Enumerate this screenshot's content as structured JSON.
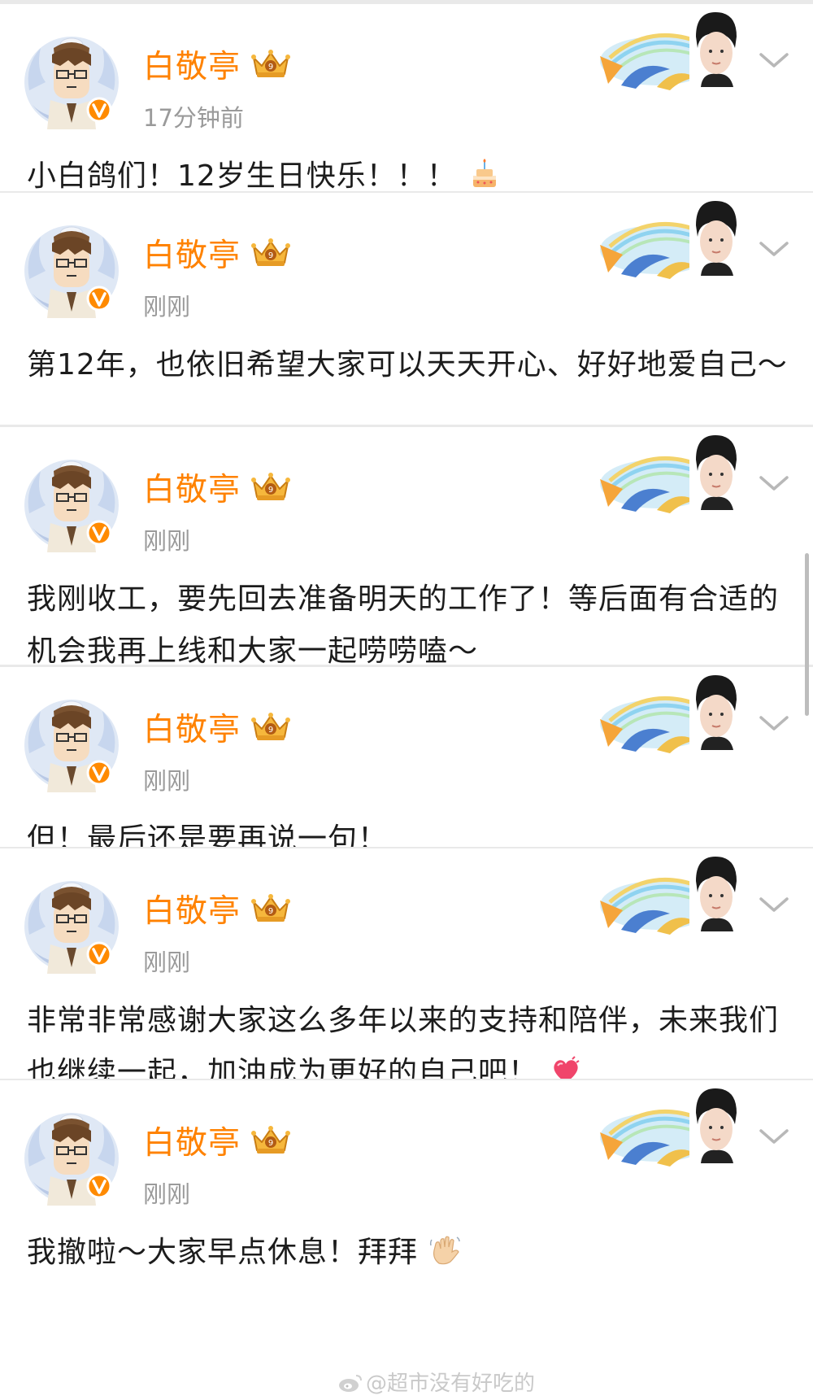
{
  "posts": [
    {
      "username": "白敬亭",
      "timestamp": "17分钟前",
      "text": "小白鸽们！12岁生日快乐！！！",
      "emoji": "birthday-cake"
    },
    {
      "username": "白敬亭",
      "timestamp": "刚刚",
      "text": "第12年，也依旧希望大家可以天天开心、好好地爱自己～",
      "emoji": ""
    },
    {
      "username": "白敬亭",
      "timestamp": "刚刚",
      "text": "我刚收工，要先回去准备明天的工作了！等后面有合适的机会我再上线和大家一起唠唠嗑～",
      "emoji": ""
    },
    {
      "username": "白敬亭",
      "timestamp": "刚刚",
      "text": "但！最后还是要再说一句！",
      "emoji": ""
    },
    {
      "username": "白敬亭",
      "timestamp": "刚刚",
      "text": "非常非常感谢大家这么多年以来的支持和陪伴，未来我们也继续一起，加油成为更好的自己吧！",
      "emoji": "heart"
    },
    {
      "username": "白敬亭",
      "timestamp": "刚刚",
      "text": "我撤啦～大家早点休息！拜拜",
      "emoji": "waving-hand"
    }
  ],
  "watermark": "@超市没有好吃的",
  "colors": {
    "username": "#ff8200",
    "timestamp": "#9a9a9a",
    "text": "#1c1c1c",
    "divider": "#e9e9e9"
  }
}
